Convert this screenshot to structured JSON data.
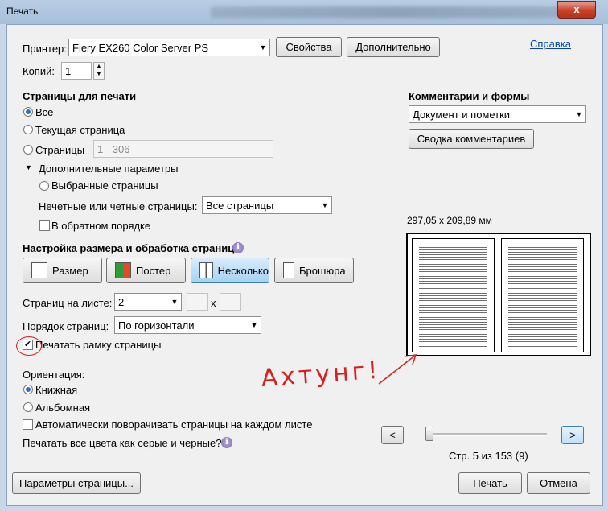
{
  "window": {
    "title": "Печать",
    "close_glyph": "x"
  },
  "printer": {
    "label": "Принтер:",
    "value": "Fiery EX260 Color Server PS",
    "properties_button": "Свойства",
    "advanced_button": "Дополнительно",
    "help_link": "Справка"
  },
  "copies": {
    "label": "Копий:",
    "value": "1"
  },
  "pages": {
    "heading": "Страницы для печати",
    "all": "Все",
    "current": "Текущая страница",
    "range": "Страницы",
    "range_placeholder": "1 - 306",
    "more_options": "Дополнительные параметры",
    "selected": "Выбранные страницы",
    "odd_even_label": "Нечетные или четные страницы:",
    "odd_even_value": "Все страницы",
    "reverse": "В обратном порядке"
  },
  "comments": {
    "heading": "Комментарии и формы",
    "value": "Документ и пометки",
    "summary_button": "Сводка комментариев"
  },
  "sizing": {
    "heading": "Настройка размера и обработка страниц",
    "buttons": [
      "Размер",
      "Постер",
      "Несколько",
      "Брошюра"
    ],
    "per_sheet_label": "Страниц на листе:",
    "per_sheet_value": "2",
    "x_glyph": "x",
    "order_label": "Порядок страниц:",
    "order_value": "По горизонтали",
    "border_label": "Печатать рамку страницы"
  },
  "orientation": {
    "heading": "Ориентация:",
    "portrait": "Книжная",
    "landscape": "Альбомная",
    "auto_rotate": "Автоматически поворачивать страницы на каждом листе"
  },
  "grayscale": {
    "label": "Печатать все цвета как серые и черные?"
  },
  "preview": {
    "size": "297,05 x 209,89 мм",
    "prev": "<",
    "next": ">",
    "page_info": "Стр. 5 из 153 (9)"
  },
  "footer": {
    "page_setup": "Параметры страницы...",
    "print": "Печать",
    "cancel": "Отмена"
  },
  "annotation": {
    "text": "Ахтунг!"
  },
  "colors": {
    "accent": "#2a6fc9",
    "annotation": "#d61f1f",
    "close_red": "#c8422a"
  },
  "icons": [
    "close-icon",
    "dropdown-arrow-icon",
    "info-icon",
    "triangle-down-icon",
    "size-icon",
    "poster-icon",
    "multiple-icon",
    "booklet-icon"
  ]
}
